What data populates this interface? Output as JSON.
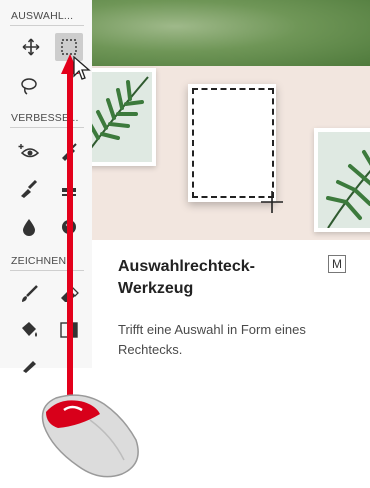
{
  "toolbar": {
    "sections": [
      {
        "label": "AUSWAHL..."
      },
      {
        "label": "VERBESSE..."
      },
      {
        "label": "ZEICHNEN"
      }
    ],
    "tools": [
      {
        "name": "move-tool",
        "icon": "move-icon",
        "selected": false
      },
      {
        "name": "rectangular-marquee-tool",
        "icon": "rectangle-marquee-icon",
        "selected": true
      },
      {
        "name": "lasso-tool",
        "icon": "lasso-icon",
        "selected": false
      },
      {
        "name": "red-eye-tool",
        "icon": "red-eye-icon",
        "selected": false
      },
      {
        "name": "spot-healing-tool",
        "icon": "healing-brush-icon",
        "selected": false
      },
      {
        "name": "smart-brush-tool",
        "icon": "smart-brush-icon",
        "selected": false
      },
      {
        "name": "clone-stamp-tool",
        "icon": "stamp-icon",
        "selected": false
      },
      {
        "name": "blur-tool",
        "icon": "drop-icon",
        "selected": false
      },
      {
        "name": "sponge-tool",
        "icon": "sponge-icon",
        "selected": false
      },
      {
        "name": "brush-tool",
        "icon": "brush-icon",
        "selected": false
      },
      {
        "name": "eraser-tool",
        "icon": "eraser-icon",
        "selected": false
      },
      {
        "name": "paint-bucket-tool",
        "icon": "paint-bucket-icon",
        "selected": false
      },
      {
        "name": "gradient-tool",
        "icon": "gradient-icon",
        "selected": false
      }
    ]
  },
  "tooltip": {
    "title": "Auswahlrechteck-Werkzeug",
    "shortcut": "M",
    "description": "Trifft eine Auswahl in Form eines Rechtecks."
  },
  "colors": {
    "arrow": "#e3001b",
    "selected_tool_bg": "#cdcdcd",
    "preview_bg": "#f2e6df"
  }
}
